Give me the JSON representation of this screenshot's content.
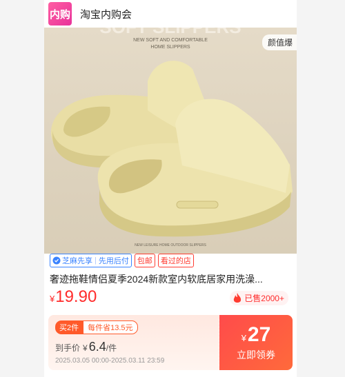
{
  "header": {
    "logo_text": "内购",
    "brand_name": "淘宝内购会"
  },
  "product_image": {
    "tag": "颜值爆",
    "banner_heading": "SOFT SLIPPERS",
    "banner_sub1": "NEW SOFT AND COMFORTABLE",
    "banner_sub2": "HOME SLIPPERS",
    "footer_caption": "NEW LEISURE HOME OUTDOOR SLIPPERS",
    "colors": {
      "slipper": "#ebe0a8",
      "background": "#e3d8c4"
    }
  },
  "tags": {
    "zhima": "芝麻先享",
    "pay_later": "先用后付",
    "free_shipping": "包邮",
    "viewed_store": "看过的店"
  },
  "title": "奢迹拖鞋情侣夏季2024新款室内软底居家用洗澡...",
  "price": {
    "currency": "¥",
    "value": "19.90"
  },
  "sold": {
    "label": "已售2000+"
  },
  "coupon": {
    "buy_badge": "买2件",
    "save_badge": "每件省13.5元",
    "unit_label": "到手价",
    "unit_currency": "¥",
    "unit_price": "6.4",
    "unit_suffix": "/件",
    "dates": "2025.03.05 00:00-2025.03.11 23:59",
    "amount_currency": "¥",
    "amount": "27",
    "claim_label": "立即领券"
  },
  "colors": {
    "accent_red": "#ff2b2b",
    "coupon_orange": "#ff5a2a",
    "tag_blue": "#3a83ff"
  }
}
